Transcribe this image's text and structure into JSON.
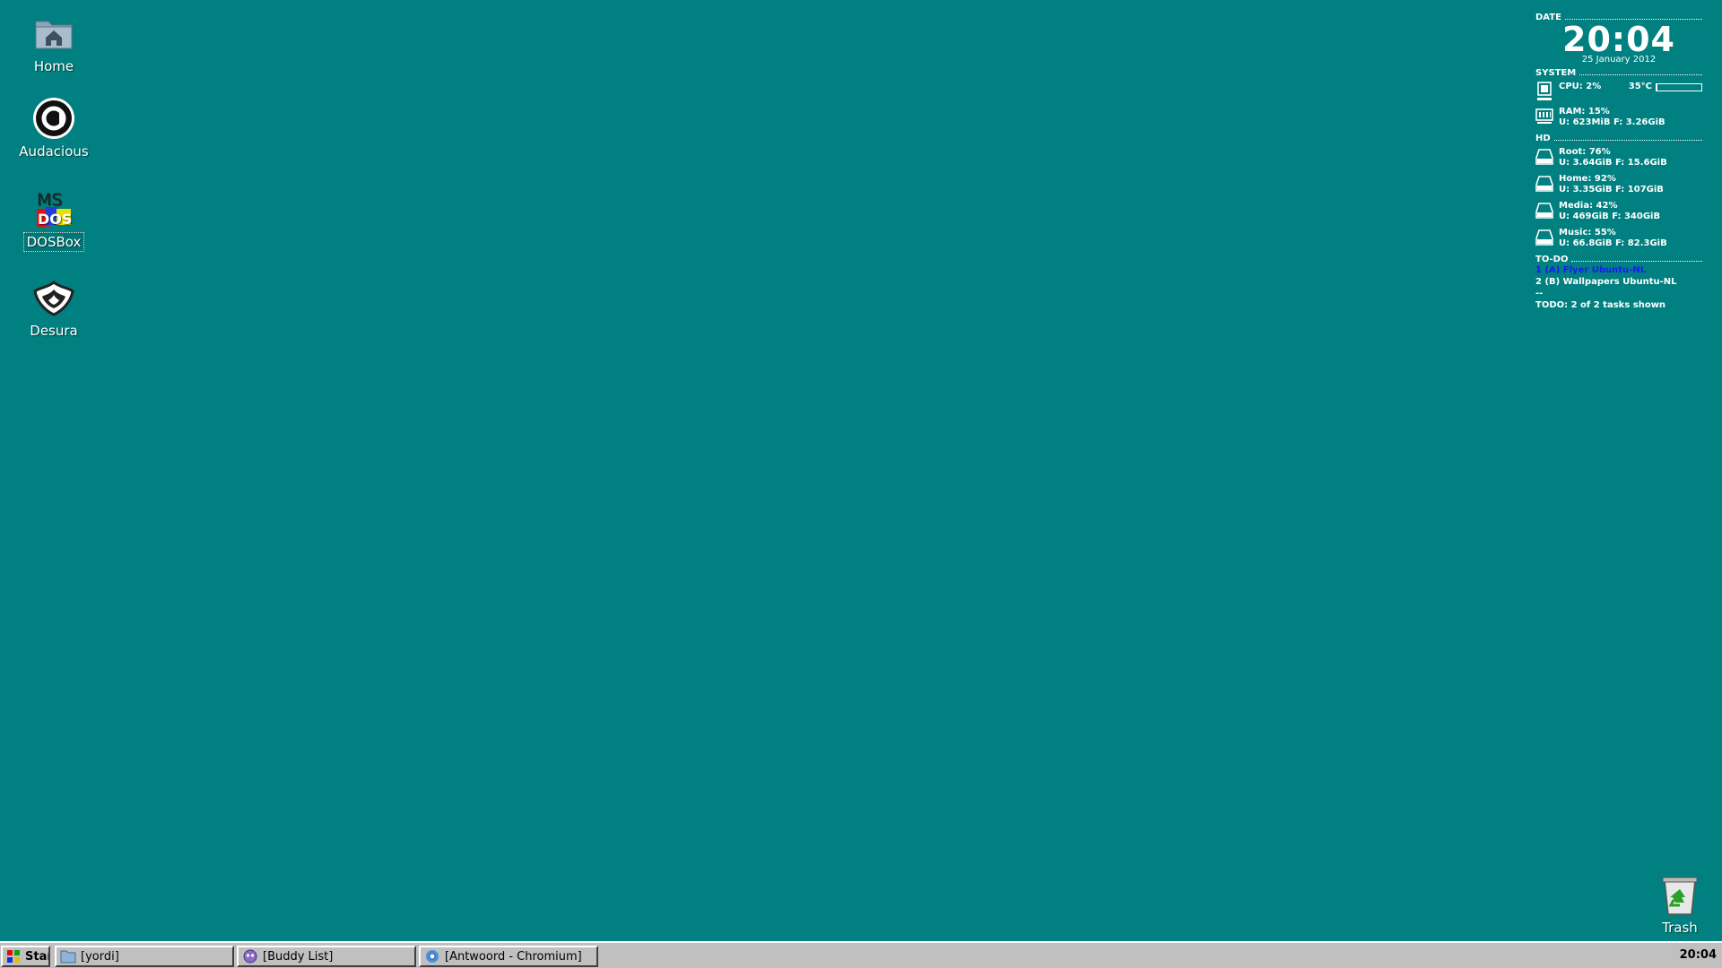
{
  "desktop": {
    "background_color": "#008080",
    "icons": [
      {
        "label": "Home",
        "icon": "home-folder-icon"
      },
      {
        "label": "Audacious",
        "icon": "audacious-icon"
      },
      {
        "label": "DOSBox",
        "icon": "msdos-icon",
        "selected": true
      },
      {
        "label": "Desura",
        "icon": "desura-icon"
      }
    ],
    "trash_label": "Trash"
  },
  "conky": {
    "date_header": "DATE",
    "time": "20:04",
    "date": "25 January 2012",
    "system_header": "SYSTEM",
    "cpu_label": "CPU: 2%",
    "cpu_temp": "35°C",
    "cpu_usage": 0.02,
    "ram_label": "RAM: 15%",
    "ram_detail": "U: 623MiB F: 3.26GiB",
    "hd_header": "HD",
    "disks": [
      {
        "label": "Root: 76%",
        "detail": "U: 3.64GiB F: 15.6GiB"
      },
      {
        "label": "Home: 92%",
        "detail": "U: 3.35GiB F: 107GiB"
      },
      {
        "label": "Media: 42%",
        "detail": "U: 469GiB F: 340GiB"
      },
      {
        "label": "Music: 55%",
        "detail": "U: 66.8GiB F: 82.3GiB"
      }
    ],
    "todo_header": "TO-DO",
    "todo_items": [
      "1 (A) Flyer Ubuntu-NL",
      "2 (B) Wallpapers Ubuntu-NL"
    ],
    "todo_separator": "--",
    "todo_summary": "TODO: 2 of 2 tasks shown",
    "todo_active_color": "#1a1af5"
  },
  "taskbar": {
    "start_label": "Start",
    "tasks": [
      {
        "label": "[yordi]",
        "icon": "folder-icon"
      },
      {
        "label": "[Buddy List]",
        "icon": "pidgin-icon"
      },
      {
        "label": "[Antwoord - Chromium]",
        "icon": "chromium-icon"
      }
    ],
    "clock": "20:04"
  }
}
